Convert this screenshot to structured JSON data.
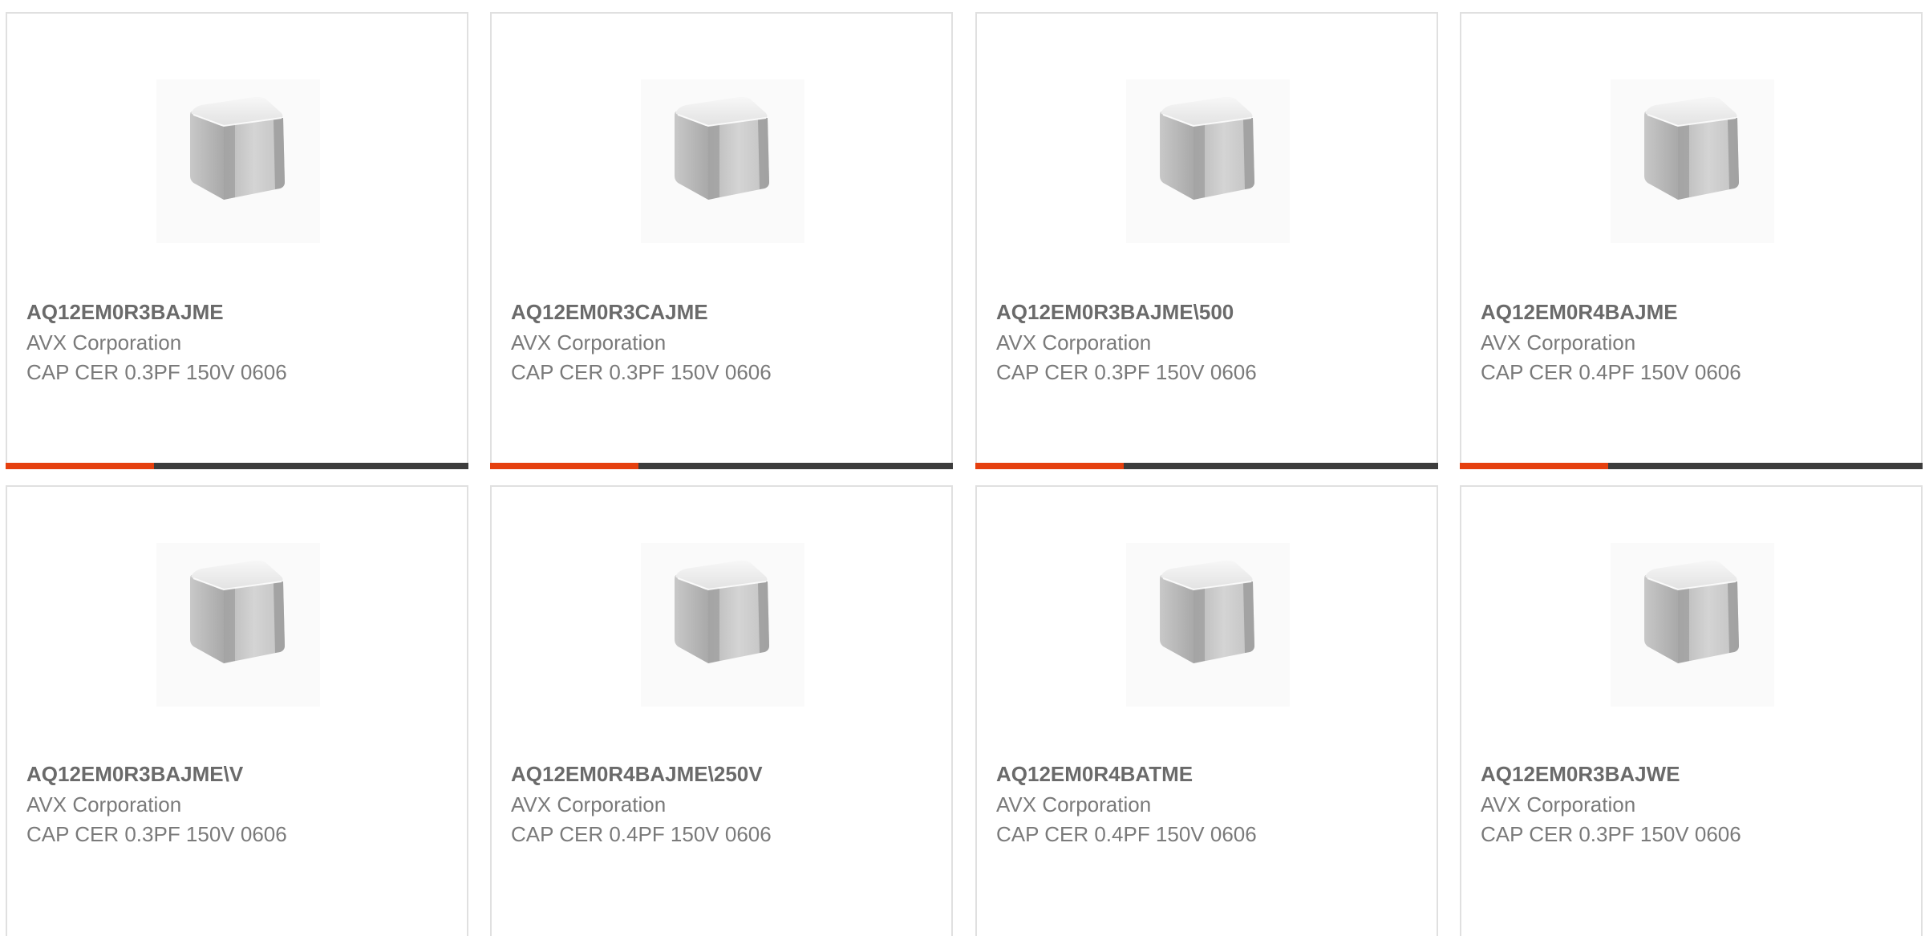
{
  "products": [
    {
      "part": "AQ12EM0R3BAJME",
      "manufacturer": "AVX Corporation",
      "description": "CAP CER 0.3PF 150V 0606",
      "progress": 0.32
    },
    {
      "part": "AQ12EM0R3CAJME",
      "manufacturer": "AVX Corporation",
      "description": "CAP CER 0.3PF 150V 0606",
      "progress": 0.32
    },
    {
      "part": "AQ12EM0R3BAJME\\500",
      "manufacturer": "AVX Corporation",
      "description": "CAP CER 0.3PF 150V 0606",
      "progress": 0.32
    },
    {
      "part": "AQ12EM0R4BAJME",
      "manufacturer": "AVX Corporation",
      "description": "CAP CER 0.4PF 150V 0606",
      "progress": 0.32
    },
    {
      "part": "AQ12EM0R3BAJME\\V",
      "manufacturer": "AVX Corporation",
      "description": "CAP CER 0.3PF 150V 0606",
      "progress": null
    },
    {
      "part": "AQ12EM0R4BAJME\\250V",
      "manufacturer": "AVX Corporation",
      "description": "CAP CER 0.4PF 150V 0606",
      "progress": null
    },
    {
      "part": "AQ12EM0R4BATME",
      "manufacturer": "AVX Corporation",
      "description": "CAP CER 0.4PF 150V 0606",
      "progress": null
    },
    {
      "part": "AQ12EM0R3BAJWE",
      "manufacturer": "AVX Corporation",
      "description": "CAP CER 0.3PF 150V 0606",
      "progress": null
    }
  ],
  "colors": {
    "accent": "#e5400f",
    "bar_track": "#3c3c3c",
    "border": "#e0e0e0",
    "title_text": "#6a6a6a",
    "body_text": "#7a7a7a"
  },
  "icons": {
    "thumbnail": "capacitor-chip-image"
  }
}
